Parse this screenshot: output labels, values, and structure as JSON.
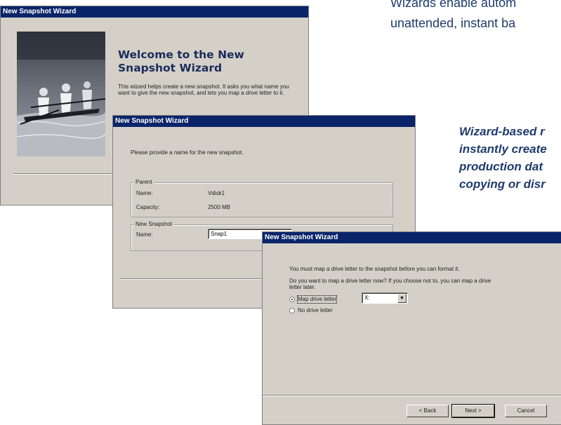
{
  "captions": {
    "top_line1": "Wizards enable autom",
    "top_line2": "unattended, instant ba",
    "italic_line1": "Wizard-based r",
    "italic_line2": "instantly create",
    "italic_line3": "production dat",
    "italic_line4": "copying or disr"
  },
  "window1": {
    "title": "New Snapshot Wizard",
    "heading_line1": "Welcome to the New",
    "heading_line2": "Snapshot Wizard",
    "intro": "This wizard helps create a new snapshot. It asks you what name you want to give the new snapshot, and lets you map a drive letter to it."
  },
  "window2": {
    "title": "New Snapshot Wizard",
    "prompt": "Please provide a name for the new snapshot.",
    "parent_group": "Parent",
    "name_label": "Name:",
    "name_value": "Vdisk1",
    "capacity_label": "Capacity:",
    "capacity_value": "2500 MB",
    "new_group": "New Snapshot",
    "new_name_label": "Name:",
    "new_name_value": "Snap1"
  },
  "window3": {
    "title": "New Snapshot Wizard",
    "line1": "You must map a drive letter to the snapshot before you can format it.",
    "line2a": "Do you want to map a drive letter now? If you choose not to, you can map a drive",
    "line2b": "letter later.",
    "radio_map": "Map drive letter",
    "radio_none": "No drive letter",
    "drive_value": "X:",
    "back": "< Back",
    "next": "Next >",
    "cancel": "Cancel"
  },
  "icons": {
    "dropdown": "chevron-down-icon"
  },
  "colors": {
    "titlebar": "#0a246a",
    "dialog": "#d4d0c8",
    "caption": "#1f3b6e"
  }
}
